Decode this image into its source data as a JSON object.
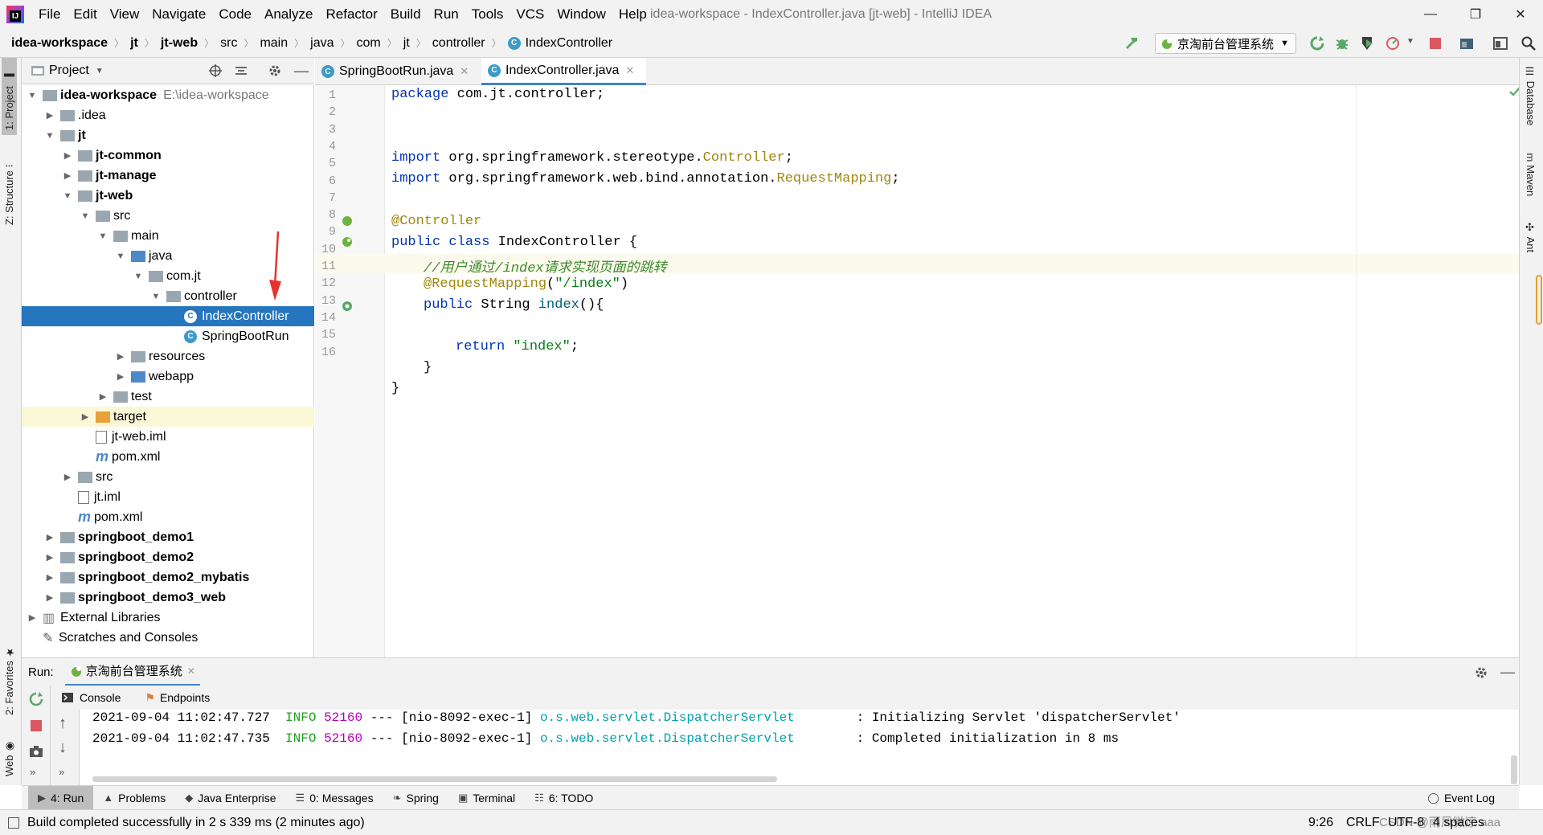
{
  "window": {
    "title": "idea-workspace - IndexController.java [jt-web] - IntelliJ IDEA",
    "logo": "IJ"
  },
  "menu": [
    "File",
    "Edit",
    "View",
    "Navigate",
    "Code",
    "Analyze",
    "Refactor",
    "Build",
    "Run",
    "Tools",
    "VCS",
    "Window",
    "Help"
  ],
  "window_controls": {
    "minimize": "—",
    "restore": "❐",
    "close": "✕"
  },
  "breadcrumbs": [
    "idea-workspace",
    "jt",
    "jt-web",
    "src",
    "main",
    "java",
    "com",
    "jt",
    "controller",
    "IndexController"
  ],
  "run_config": "京淘前台管理系统",
  "left_stripe": {
    "project": "1: Project",
    "structure": "Z: Structure",
    "favorites": "2: Favorites",
    "web": "Web"
  },
  "right_stripe": {
    "database": "Database",
    "maven": "Maven",
    "ant": "Ant"
  },
  "project": {
    "header": "Project",
    "tree": [
      {
        "label": "idea-workspace",
        "extra": "E:\\idea-workspace",
        "bold": true,
        "arrow": "▼",
        "type": "module"
      },
      {
        "label": ".idea",
        "arrow": "▶",
        "type": "folder"
      },
      {
        "label": "jt",
        "bold": true,
        "arrow": "▼",
        "type": "module"
      },
      {
        "label": "jt-common",
        "bold": true,
        "arrow": "▶",
        "type": "module"
      },
      {
        "label": "jt-manage",
        "bold": true,
        "arrow": "▶",
        "type": "module"
      },
      {
        "label": "jt-web",
        "bold": true,
        "arrow": "▼",
        "type": "module"
      },
      {
        "label": "src",
        "arrow": "▼",
        "type": "folder"
      },
      {
        "label": "main",
        "arrow": "▼",
        "type": "folder"
      },
      {
        "label": "java",
        "arrow": "▼",
        "type": "srcfolder"
      },
      {
        "label": "com.jt",
        "arrow": "▼",
        "type": "package"
      },
      {
        "label": "controller",
        "arrow": "▼",
        "type": "package"
      },
      {
        "label": "IndexController",
        "arrow": "",
        "type": "class",
        "selected": true
      },
      {
        "label": "SpringBootRun",
        "arrow": "",
        "type": "spring-class"
      },
      {
        "label": "resources",
        "arrow": "▶",
        "type": "resfolder"
      },
      {
        "label": "webapp",
        "arrow": "▶",
        "type": "webfolder"
      },
      {
        "label": "test",
        "arrow": "▶",
        "type": "folder"
      },
      {
        "label": "target",
        "arrow": "▶",
        "type": "excluded",
        "highlight": true
      },
      {
        "label": "jt-web.iml",
        "arrow": "",
        "type": "iml"
      },
      {
        "label": "pom.xml",
        "arrow": "",
        "type": "maven"
      },
      {
        "label": "src",
        "arrow": "▶",
        "type": "folder"
      },
      {
        "label": "jt.iml",
        "arrow": "",
        "type": "iml"
      },
      {
        "label": "pom.xml",
        "arrow": "",
        "type": "maven"
      },
      {
        "label": "springboot_demo1",
        "bold": true,
        "arrow": "▶",
        "type": "module"
      },
      {
        "label": "springboot_demo2",
        "bold": true,
        "arrow": "▶",
        "type": "module"
      },
      {
        "label": "springboot_demo2_mybatis",
        "bold": true,
        "arrow": "▶",
        "type": "module"
      },
      {
        "label": "springboot_demo3_web",
        "bold": true,
        "arrow": "▶",
        "type": "module"
      },
      {
        "label": "External Libraries",
        "arrow": "▶",
        "type": "libs"
      },
      {
        "label": "Scratches and Consoles",
        "arrow": "",
        "type": "scratch"
      }
    ]
  },
  "tabs": [
    {
      "label": "SpringBootRun.java",
      "active": false
    },
    {
      "label": "IndexController.java",
      "active": true
    }
  ],
  "code": {
    "line_numbers": [
      "1",
      "2",
      "3",
      "4",
      "5",
      "6",
      "7",
      "8",
      "9",
      "10",
      "11",
      "12",
      "13",
      "14",
      "15",
      "16"
    ],
    "l1_kw": "package",
    "l1_rest": " com.jt.controller;",
    "l4_kw": "import",
    "l4_rest": " org.springframework.stereotype.",
    "l4_cls": "Controller",
    "l4_end": ";",
    "l5_kw": "import",
    "l5_rest": " org.springframework.web.bind.annotation.",
    "l5_cls": "RequestMapping",
    "l5_end": ";",
    "l7_ann": "@Controller",
    "l8_kw": "public class",
    "l8_rest": " IndexController {",
    "l9_cmt": "//用户通过/index请求实现页面的跳转",
    "l10_ann": "@RequestMapping",
    "l10_p1": "(",
    "l10_str": "\"/index\"",
    "l10_p2": ")",
    "l11_kw": "public",
    "l11_rest": " String ",
    "l11_meth": "index",
    "l11_end": "(){",
    "l13_kw": "return",
    "l13_sp": " ",
    "l13_str": "\"index\"",
    "l13_end": ";",
    "l14": "}",
    "l15": "}"
  },
  "run": {
    "label": "Run:",
    "tab": "京淘前台管理系统",
    "console_tab": "Console",
    "endpoints_tab": "Endpoints",
    "logs": [
      {
        "ts": "2021-09-04 11:02:47.727",
        "level": "INFO",
        "pid": "52160",
        "sep": "---",
        "thread": "[nio-8092-exec-1]",
        "logger": "o.s.web.servlet.DispatcherServlet",
        "msg": ": Initializing Servlet 'dispatcherServlet'"
      },
      {
        "ts": "2021-09-04 11:02:47.735",
        "level": "INFO",
        "pid": "52160",
        "sep": "---",
        "thread": "[nio-8092-exec-1]",
        "logger": "o.s.web.servlet.DispatcherServlet",
        "msg": ": Completed initialization in 8 ms"
      }
    ]
  },
  "bottom_tabs": [
    {
      "label": "4: Run",
      "icon": "▶",
      "selected": true
    },
    {
      "label": "Problems",
      "icon": "▲"
    },
    {
      "label": "Java Enterprise",
      "icon": "◆"
    },
    {
      "label": "0: Messages",
      "icon": "☰"
    },
    {
      "label": "Spring",
      "icon": "❧"
    },
    {
      "label": "Terminal",
      "icon": "▣"
    },
    {
      "label": "6: TODO",
      "icon": "☷"
    }
  ],
  "event_log": "Event Log",
  "status": {
    "message": "Build completed successfully in 2 s 339 ms (2 minutes ago)",
    "position": "9:26",
    "line_sep": "CRLF",
    "encoding": "UTF-8",
    "indent": "4 spaces",
    "watermark": "CSDN @雨风微凉 aaa"
  },
  "colors": {
    "selection": "#2675bf",
    "keyword": "#0033b3",
    "annotation": "#9e880d",
    "string": "#067d17",
    "info": "#1ca01c",
    "logger": "#00a0b0",
    "arrow": "#e8322e"
  }
}
